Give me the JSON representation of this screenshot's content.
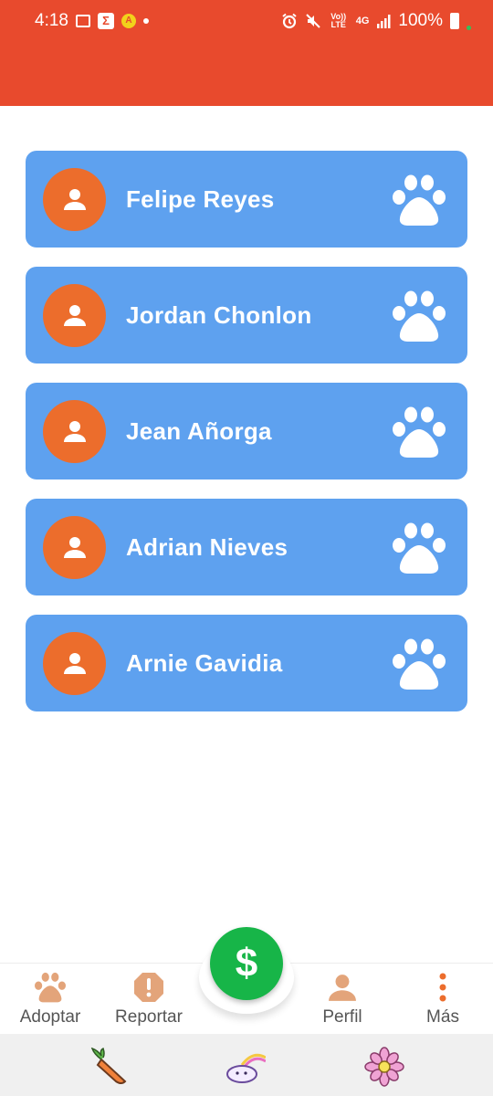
{
  "status_bar": {
    "time": "4:18",
    "battery_percent": "100%",
    "network": "4G",
    "volte": "Vo)) LTE",
    "icons": [
      "gallery-icon",
      "sigma-icon",
      "warning-icon",
      "notification-dot-icon",
      "alarm-icon",
      "mute-icon",
      "volte-icon",
      "network-4g-icon",
      "signal-icon",
      "battery-icon"
    ]
  },
  "colors": {
    "header": "#e84a2d",
    "card": "#5ea1ef",
    "avatar": "#ec6d2c",
    "fab": "#17b548",
    "nav_icon": "#e3a47a"
  },
  "contacts": [
    {
      "name": "Felipe Reyes",
      "avatar_icon": "person-icon",
      "action_icon": "paw-icon"
    },
    {
      "name": "Jordan Chonlon",
      "avatar_icon": "person-icon",
      "action_icon": "paw-icon"
    },
    {
      "name": "Jean Añorga",
      "avatar_icon": "person-icon",
      "action_icon": "paw-icon"
    },
    {
      "name": "Adrian Nieves",
      "avatar_icon": "person-icon",
      "action_icon": "paw-icon"
    },
    {
      "name": "Arnie Gavidia",
      "avatar_icon": "person-icon",
      "action_icon": "paw-icon"
    }
  ],
  "fab": {
    "label": "$",
    "icon": "dollar-icon"
  },
  "bottom_nav": {
    "items": [
      {
        "label": "Adoptar",
        "icon": "paw-icon"
      },
      {
        "label": "Reportar",
        "icon": "alert-octagon-icon"
      },
      {
        "label": "Perfil",
        "icon": "person-icon"
      },
      {
        "label": "Más",
        "icon": "more-vertical-icon"
      }
    ]
  },
  "tray": {
    "icons": [
      "carrot-sticker-icon",
      "cloud-rainbow-sticker-icon",
      "flower-sticker-icon"
    ]
  }
}
